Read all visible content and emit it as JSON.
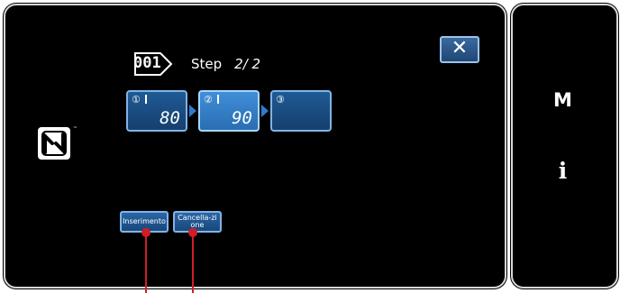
{
  "header": {
    "program_number": "001",
    "step_label": "Step",
    "step_count": "2/ 2"
  },
  "steps": [
    {
      "number": "①",
      "value": "80",
      "active": false
    },
    {
      "number": "②",
      "value": "90",
      "active": true
    },
    {
      "number": "③",
      "value": "",
      "active": false
    }
  ],
  "buttons": {
    "close": "✕",
    "insert": "Inserimento",
    "cancel": "Cancella-zione"
  },
  "side": {
    "menu": "M",
    "info": "i"
  },
  "nfc": {
    "tm": "™"
  }
}
